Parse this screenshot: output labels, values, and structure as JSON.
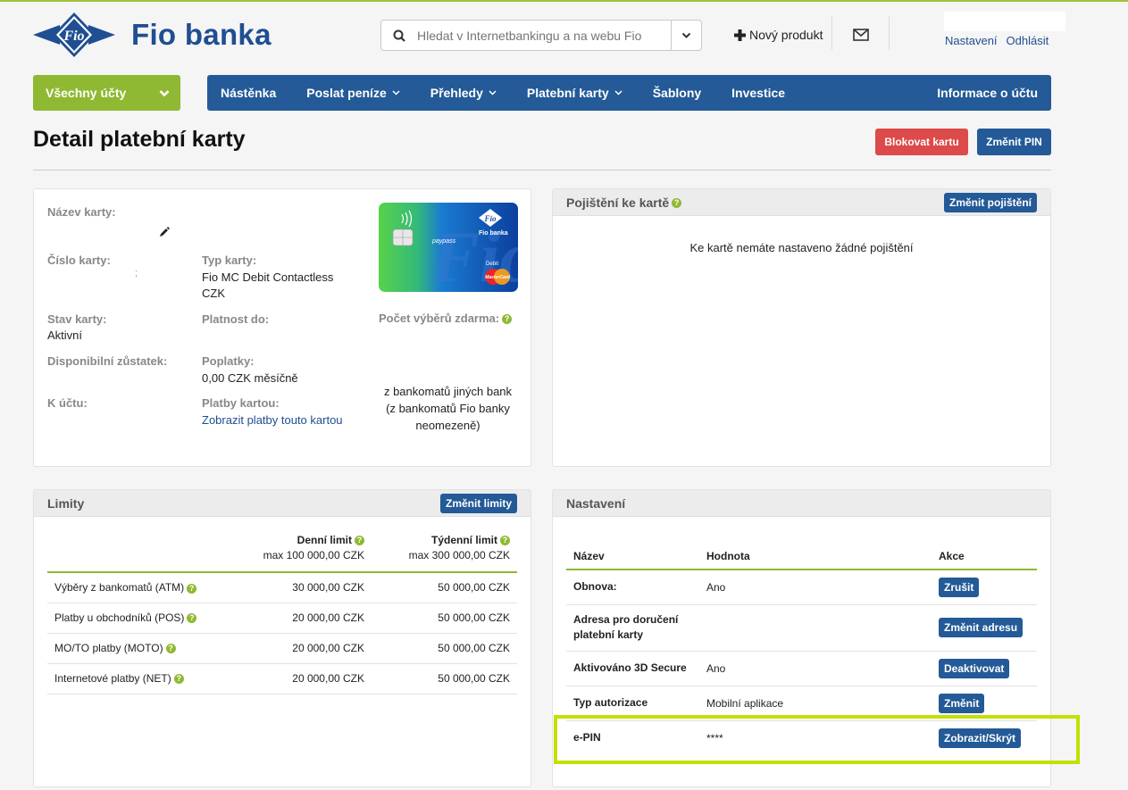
{
  "header": {
    "logo_emblem_text": "Fio",
    "logo_text": "Fio banka",
    "search_placeholder": "Hledat v Internetbankingu a na webu Fio",
    "new_product_label": "Nový produkt",
    "settings_link": "Nastavení",
    "logout_link": "Odhlásit"
  },
  "nav": {
    "accounts_label": "Všechny účty",
    "items": [
      {
        "label": "Nástěnka",
        "dropdown": false
      },
      {
        "label": "Poslat peníze",
        "dropdown": true
      },
      {
        "label": "Přehledy",
        "dropdown": true
      },
      {
        "label": "Platební karty",
        "dropdown": true
      },
      {
        "label": "Šablony",
        "dropdown": false
      },
      {
        "label": "Investice",
        "dropdown": false
      }
    ],
    "account_info_label": "Informace o účtu"
  },
  "page": {
    "title": "Detail platební karty",
    "block_card_label": "Blokovat kartu",
    "change_pin_label": "Změnit PIN"
  },
  "card_info": {
    "card_name_label": "Název karty:",
    "card_number_label": "Číslo karty:",
    "card_number_value": ";",
    "card_type_label": "Typ karty:",
    "card_type_value": "Fio MC Debit Contactless",
    "card_currency": "CZK",
    "card_state_label": "Stav karty:",
    "card_state_value": "Aktivní",
    "valid_until_label": "Platnost do:",
    "free_withdrawals_label": "Počet výběrů zdarma:",
    "available_balance_label": "Disponibilní zůstatek:",
    "fees_label": "Poplatky:",
    "fees_value": "0,00 CZK měsíčně",
    "account_label": "K účtu:",
    "card_payments_label": "Platby kartou:",
    "card_payments_link": "Zobrazit platby touto kartou",
    "free_withdrawals_note_1": "z bankomatů jiných bank",
    "free_withdrawals_note_2": "(z bankomatů Fio banky",
    "free_withdrawals_note_3": "neomezeně)",
    "card_image": {
      "brand": "Fio",
      "bank": "Fio banka",
      "paypass": "paypass",
      "debit": "Debit",
      "mastercard": "MasterCard"
    }
  },
  "insurance": {
    "title": "Pojištění ke kartě",
    "change_label": "Změnit pojištění",
    "empty_text": "Ke kartě nemáte nastaveno žádné pojištění"
  },
  "limits": {
    "title": "Limity",
    "change_label": "Změnit limity",
    "daily_header": "Denní limit",
    "daily_max": "max 100 000,00 CZK",
    "weekly_header": "Týdenní limit",
    "weekly_max": "max 300 000,00 CZK",
    "rows": [
      {
        "name": "Výběry z bankomatů (ATM)",
        "daily": "30 000,00 CZK",
        "weekly": "50 000,00 CZK"
      },
      {
        "name": "Platby u obchodníků (POS)",
        "daily": "20 000,00 CZK",
        "weekly": "50 000,00 CZK"
      },
      {
        "name": "MO/TO platby (MOTO)",
        "daily": "20 000,00 CZK",
        "weekly": "50 000,00 CZK"
      },
      {
        "name": "Internetové platby (NET)",
        "daily": "20 000,00 CZK",
        "weekly": "50 000,00 CZK"
      }
    ]
  },
  "settings": {
    "title": "Nastavení",
    "col_name": "Název",
    "col_value": "Hodnota",
    "col_action": "Akce",
    "rows": [
      {
        "name": "Obnova:",
        "value": "Ano",
        "action": "Zrušit"
      },
      {
        "name": "Adresa pro doručení platební karty",
        "value": "",
        "action": "Změnit adresu"
      },
      {
        "name": "Aktivováno 3D Secure",
        "value": "Ano",
        "action": "Deaktivovat"
      },
      {
        "name": "Typ autorizace",
        "value": "Mobilní aplikace",
        "action": "Změnit"
      },
      {
        "name": "e-PIN",
        "value": "****",
        "action": "Zobrazit/Skrýt"
      }
    ]
  },
  "colors": {
    "brand_blue": "#235a97",
    "accent_green": "#8fb932",
    "danger_red": "#dc4a4a",
    "highlight_green": "#c3e000"
  }
}
